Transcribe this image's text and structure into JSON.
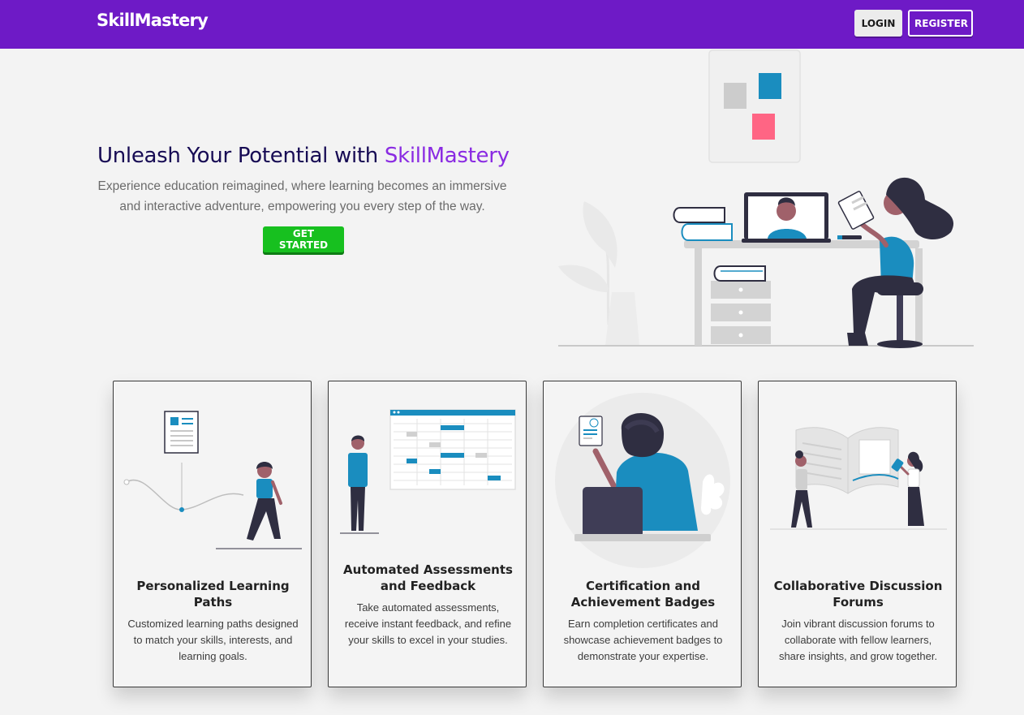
{
  "nav": {
    "brand": "SkillMastery",
    "login_label": "LOGIN",
    "register_label": "REGISTER"
  },
  "hero": {
    "title_main": "Unleash Your Potential with ",
    "title_accent": "SkillMastery",
    "subtitle": "Experience education reimagined, where learning becomes an immersive and interactive adventure, empowering you every step of the way.",
    "cta_label": "GET STARTED"
  },
  "features": [
    {
      "title": "Personalized Learning Paths",
      "text": "Customized learning paths designed to match your skills, interests, and learning goals.",
      "icon": "learning-path-illustration"
    },
    {
      "title": "Automated Assessments and Feedback",
      "text": "Take automated assessments, receive instant feedback, and refine your skills to excel in your studies.",
      "icon": "assessment-schedule-illustration"
    },
    {
      "title": "Certification and Achievement Badges",
      "text": "Earn completion certificates and showcase achievement badges to demonstrate your expertise.",
      "icon": "certificate-illustration"
    },
    {
      "title": "Collaborative Discussion Forums",
      "text": "Join vibrant discussion forums to collaborate with fellow learners, share insights, and grow together.",
      "icon": "forum-book-illustration"
    }
  ],
  "colors": {
    "navbar": "#6e1ac6",
    "accent": "#8a2be2",
    "cta": "#17c01f",
    "title": "#170b54",
    "illustration_blue": "#1a8dbf",
    "illustration_pink": "#ff6584",
    "illustration_dark": "#2f2e41"
  }
}
